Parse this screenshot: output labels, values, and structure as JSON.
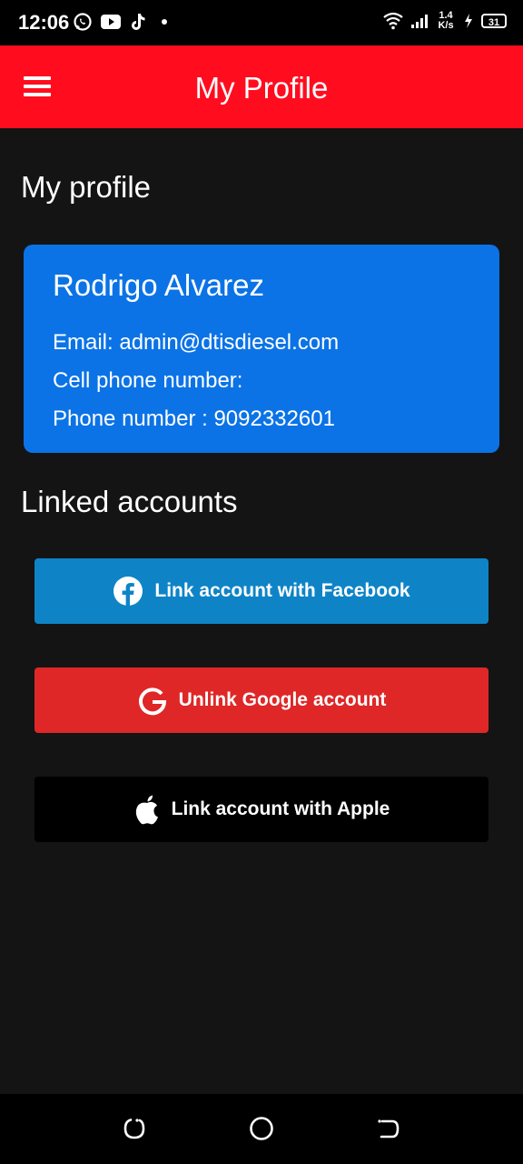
{
  "status_bar": {
    "time": "12:06",
    "net_speed_value": "1.4",
    "net_speed_unit": "K/s",
    "battery": "31",
    "icons": [
      "whatsapp-icon",
      "youtube-icon",
      "tiktok-icon",
      "dot-icon",
      "wifi-icon",
      "signal-icon",
      "charging-icon",
      "battery-icon"
    ]
  },
  "app_bar": {
    "title": "My Profile",
    "menu_icon": "menu-icon"
  },
  "profile_section": {
    "title": "My profile",
    "name": "Rodrigo Alvarez",
    "email_line": "Email: admin@dtisdiesel.com",
    "cell_line": "Cell phone number:",
    "phone_line": "Phone number : 9092332601"
  },
  "linked_section": {
    "title": "Linked accounts",
    "buttons": [
      {
        "label": "Link account with Facebook",
        "icon": "facebook-icon",
        "color": "#0e84c7"
      },
      {
        "label": "Unlink Google account",
        "icon": "google-icon",
        "color": "#df2727"
      },
      {
        "label": "Link account with Apple",
        "icon": "apple-icon",
        "color": "#000000"
      }
    ]
  },
  "colors": {
    "app_bar": "#ff0d1f",
    "background": "#141414",
    "card": "#0b73e6"
  },
  "nav_bar": {
    "icons": [
      "recents-icon",
      "home-icon",
      "back-icon"
    ]
  }
}
